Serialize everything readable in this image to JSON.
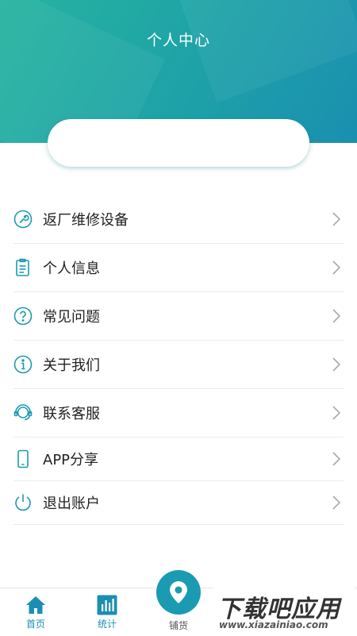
{
  "header": {
    "title": "个人中心"
  },
  "menu": [
    {
      "label": "返厂维修设备",
      "icon": "wrench-icon"
    },
    {
      "label": "个人信息",
      "icon": "clipboard-icon"
    },
    {
      "label": "常见问题",
      "icon": "question-icon"
    },
    {
      "label": "关于我们",
      "icon": "info-icon"
    },
    {
      "label": "联系客服",
      "icon": "headset-icon"
    },
    {
      "label": "APP分享",
      "icon": "phone-icon"
    },
    {
      "label": "退出账户",
      "icon": "power-icon"
    }
  ],
  "tabbar": {
    "home": "首页",
    "stats": "统计",
    "center": "铺货"
  },
  "watermark": {
    "main": "下载吧应用",
    "sub": "www.xiazainiao.com"
  },
  "colors": {
    "accent": "#1b9bb2",
    "header_start": "#26b3a0",
    "header_end": "#1a8fb0"
  }
}
